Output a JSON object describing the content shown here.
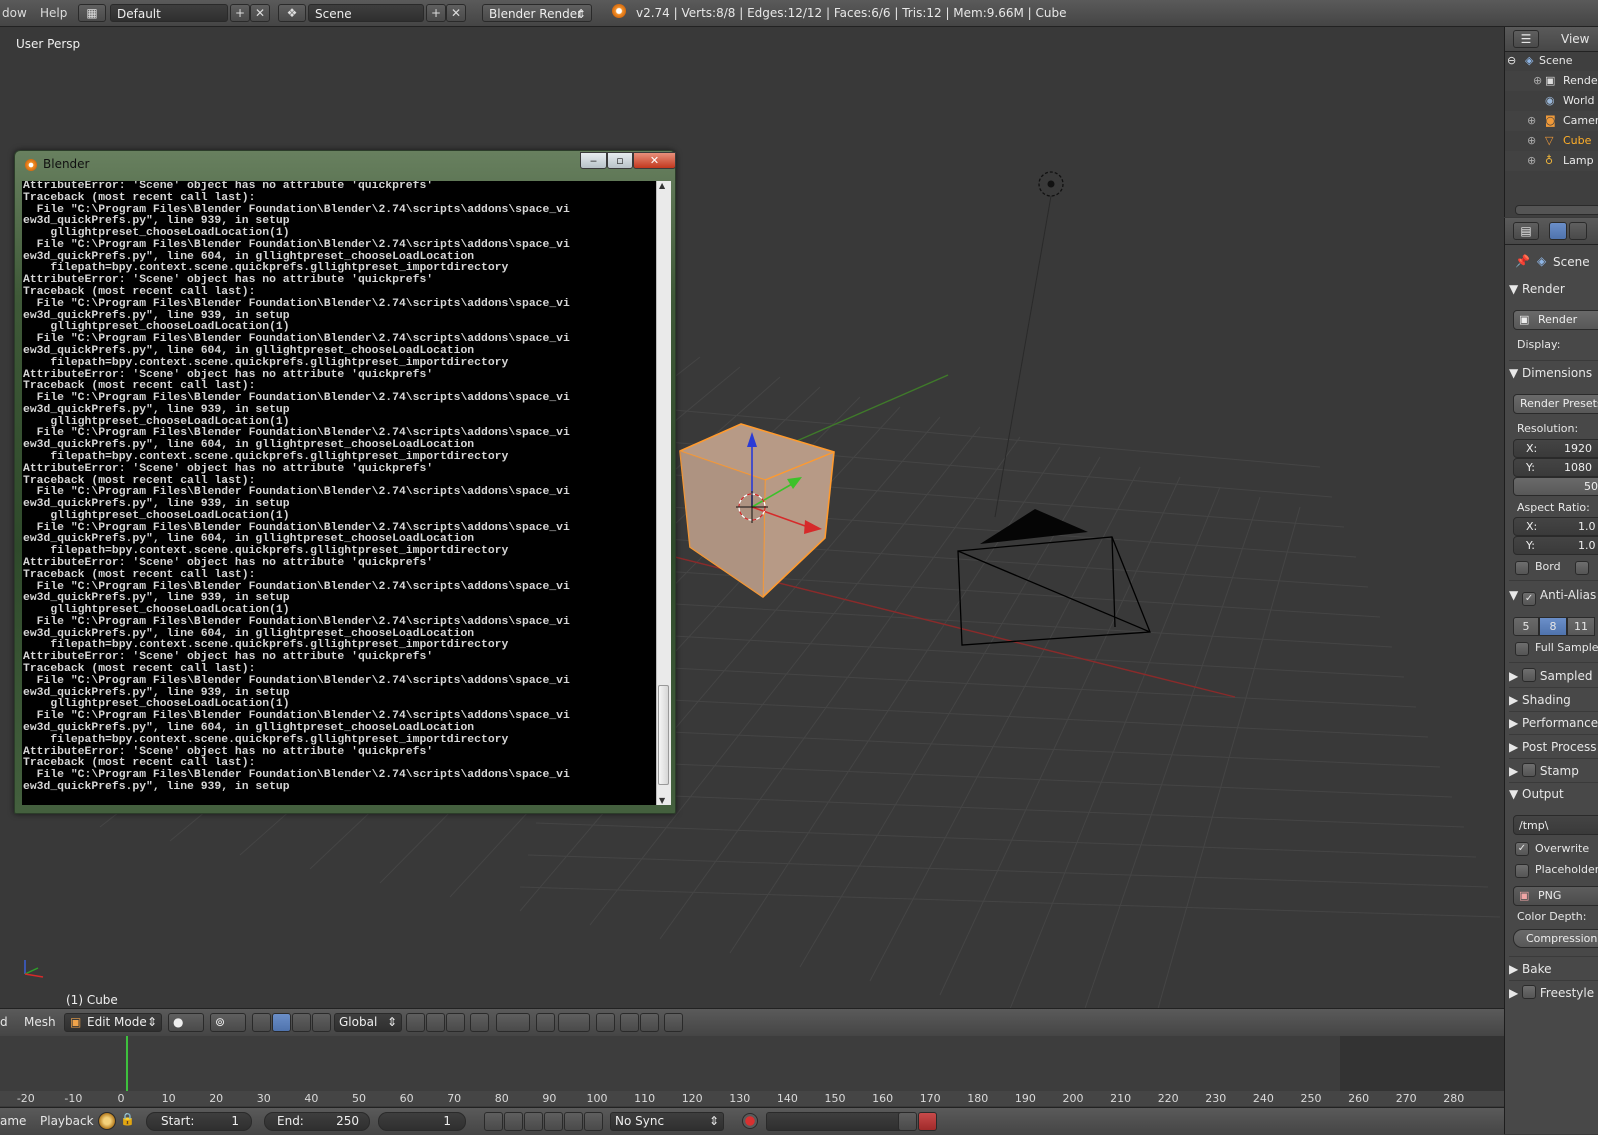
{
  "topbar": {
    "menu_partial": "dow",
    "menu_help": "Help",
    "layout_name": "Default",
    "scene_name": "Scene",
    "render_engine": "Blender Render",
    "stats": "v2.74 | Verts:8/8 | Edges:12/12 | Faces:6/6 | Tris:12 | Mem:9.66M | Cube"
  },
  "viewport": {
    "view_label": "User Persp",
    "object_label": "(1) Cube"
  },
  "outliner": {
    "view_menu": "View",
    "items": [
      "Scene",
      "Rende",
      "World",
      "Camer",
      "Cube",
      "Lamp"
    ]
  },
  "properties": {
    "context": "Scene",
    "render_panel": "Render",
    "render_button": "Render",
    "display_label": "Display:",
    "dimensions_panel": "Dimensions",
    "render_presets": "Render Presets",
    "resolution_label": "Resolution:",
    "res_x_label": "X:",
    "res_x": "1920",
    "res_y_label": "Y:",
    "res_y": "1080",
    "res_pct": "50",
    "aspect_label": "Aspect Ratio:",
    "aspect_x_label": "X:",
    "aspect_x": "1.0",
    "aspect_y_label": "Y:",
    "aspect_y": "1.0",
    "border_label": "Bord",
    "antialias_panel": "Anti-Alias",
    "aa_samples": [
      "5",
      "8",
      "11"
    ],
    "full_sample": "Full Sample",
    "sampled_panel": "Sampled",
    "shading_panel": "Shading",
    "performance_panel": "Performance",
    "postprocess_panel": "Post Process",
    "stamp_panel": "Stamp",
    "output_panel": "Output",
    "output_path": "/tmp\\",
    "overwrite": "Overwrite",
    "placeholders": "Placeholders",
    "file_format": "PNG",
    "color_depth": "Color Depth:",
    "compression": "Compression:",
    "bake_panel": "Bake",
    "freestyle_panel": "Freestyle"
  },
  "view3d_header": {
    "menu_partial": "d",
    "mesh_menu": "Mesh",
    "mode": "Edit Mode",
    "orientation": "Global"
  },
  "timeline": {
    "ticks": [
      "-20",
      "-10",
      "0",
      "10",
      "20",
      "30",
      "40",
      "50",
      "60",
      "70",
      "80",
      "90",
      "100",
      "110",
      "120",
      "130",
      "140",
      "150",
      "160",
      "170",
      "180",
      "190",
      "200",
      "210",
      "220",
      "230",
      "240",
      "250",
      "260",
      "270",
      "280"
    ],
    "current_frame_value": 1,
    "footer_partial": "ame",
    "playback": "Playback",
    "start_label": "Start:",
    "start": "1",
    "end_label": "End:",
    "end": "250",
    "current": "1",
    "sync": "No Sync"
  },
  "console": {
    "title": "Blender",
    "minimize": "‒",
    "maximize": "▫",
    "close": "✕",
    "lines": [
      "AttributeError: 'Scene' object has no attribute 'quickprefs'",
      "Traceback (most recent call last):",
      "  File \"C:\\Program Files\\Blender Foundation\\Blender\\2.74\\scripts\\addons\\space_vi",
      "ew3d_quickPrefs.py\", line 939, in setup",
      "    gllightpreset_chooseLoadLocation(1)",
      "  File \"C:\\Program Files\\Blender Foundation\\Blender\\2.74\\scripts\\addons\\space_vi",
      "ew3d_quickPrefs.py\", line 604, in gllightpreset_chooseLoadLocation",
      "    filepath=bpy.context.scene.quickprefs.gllightpreset_importdirectory",
      "AttributeError: 'Scene' object has no attribute 'quickprefs'",
      "Traceback (most recent call last):",
      "  File \"C:\\Program Files\\Blender Foundation\\Blender\\2.74\\scripts\\addons\\space_vi",
      "ew3d_quickPrefs.py\", line 939, in setup",
      "    gllightpreset_chooseLoadLocation(1)",
      "  File \"C:\\Program Files\\Blender Foundation\\Blender\\2.74\\scripts\\addons\\space_vi",
      "ew3d_quickPrefs.py\", line 604, in gllightpreset_chooseLoadLocation",
      "    filepath=bpy.context.scene.quickprefs.gllightpreset_importdirectory",
      "AttributeError: 'Scene' object has no attribute 'quickprefs'",
      "Traceback (most recent call last):",
      "  File \"C:\\Program Files\\Blender Foundation\\Blender\\2.74\\scripts\\addons\\space_vi",
      "ew3d_quickPrefs.py\", line 939, in setup",
      "    gllightpreset_chooseLoadLocation(1)",
      "  File \"C:\\Program Files\\Blender Foundation\\Blender\\2.74\\scripts\\addons\\space_vi",
      "ew3d_quickPrefs.py\", line 604, in gllightpreset_chooseLoadLocation",
      "    filepath=bpy.context.scene.quickprefs.gllightpreset_importdirectory",
      "AttributeError: 'Scene' object has no attribute 'quickprefs'",
      "Traceback (most recent call last):",
      "  File \"C:\\Program Files\\Blender Foundation\\Blender\\2.74\\scripts\\addons\\space_vi",
      "ew3d_quickPrefs.py\", line 939, in setup",
      "    gllightpreset_chooseLoadLocation(1)",
      "  File \"C:\\Program Files\\Blender Foundation\\Blender\\2.74\\scripts\\addons\\space_vi",
      "ew3d_quickPrefs.py\", line 604, in gllightpreset_chooseLoadLocation",
      "    filepath=bpy.context.scene.quickprefs.gllightpreset_importdirectory",
      "AttributeError: 'Scene' object has no attribute 'quickprefs'",
      "Traceback (most recent call last):",
      "  File \"C:\\Program Files\\Blender Foundation\\Blender\\2.74\\scripts\\addons\\space_vi",
      "ew3d_quickPrefs.py\", line 939, in setup",
      "    gllightpreset_chooseLoadLocation(1)",
      "  File \"C:\\Program Files\\Blender Foundation\\Blender\\2.74\\scripts\\addons\\space_vi",
      "ew3d_quickPrefs.py\", line 604, in gllightpreset_chooseLoadLocation",
      "    filepath=bpy.context.scene.quickprefs.gllightpreset_importdirectory",
      "AttributeError: 'Scene' object has no attribute 'quickprefs'",
      "Traceback (most recent call last):",
      "  File \"C:\\Program Files\\Blender Foundation\\Blender\\2.74\\scripts\\addons\\space_vi",
      "ew3d_quickPrefs.py\", line 939, in setup",
      "    gllightpreset_chooseLoadLocation(1)",
      "  File \"C:\\Program Files\\Blender Foundation\\Blender\\2.74\\scripts\\addons\\space_vi",
      "ew3d_quickPrefs.py\", line 604, in gllightpreset_chooseLoadLocation",
      "    filepath=bpy.context.scene.quickprefs.gllightpreset_importdirectory",
      "AttributeError: 'Scene' object has no attribute 'quickprefs'",
      "Traceback (most recent call last):",
      "  File \"C:\\Program Files\\Blender Foundation\\Blender\\2.74\\scripts\\addons\\space_vi",
      "ew3d_quickPrefs.py\", line 939, in setup"
    ]
  }
}
